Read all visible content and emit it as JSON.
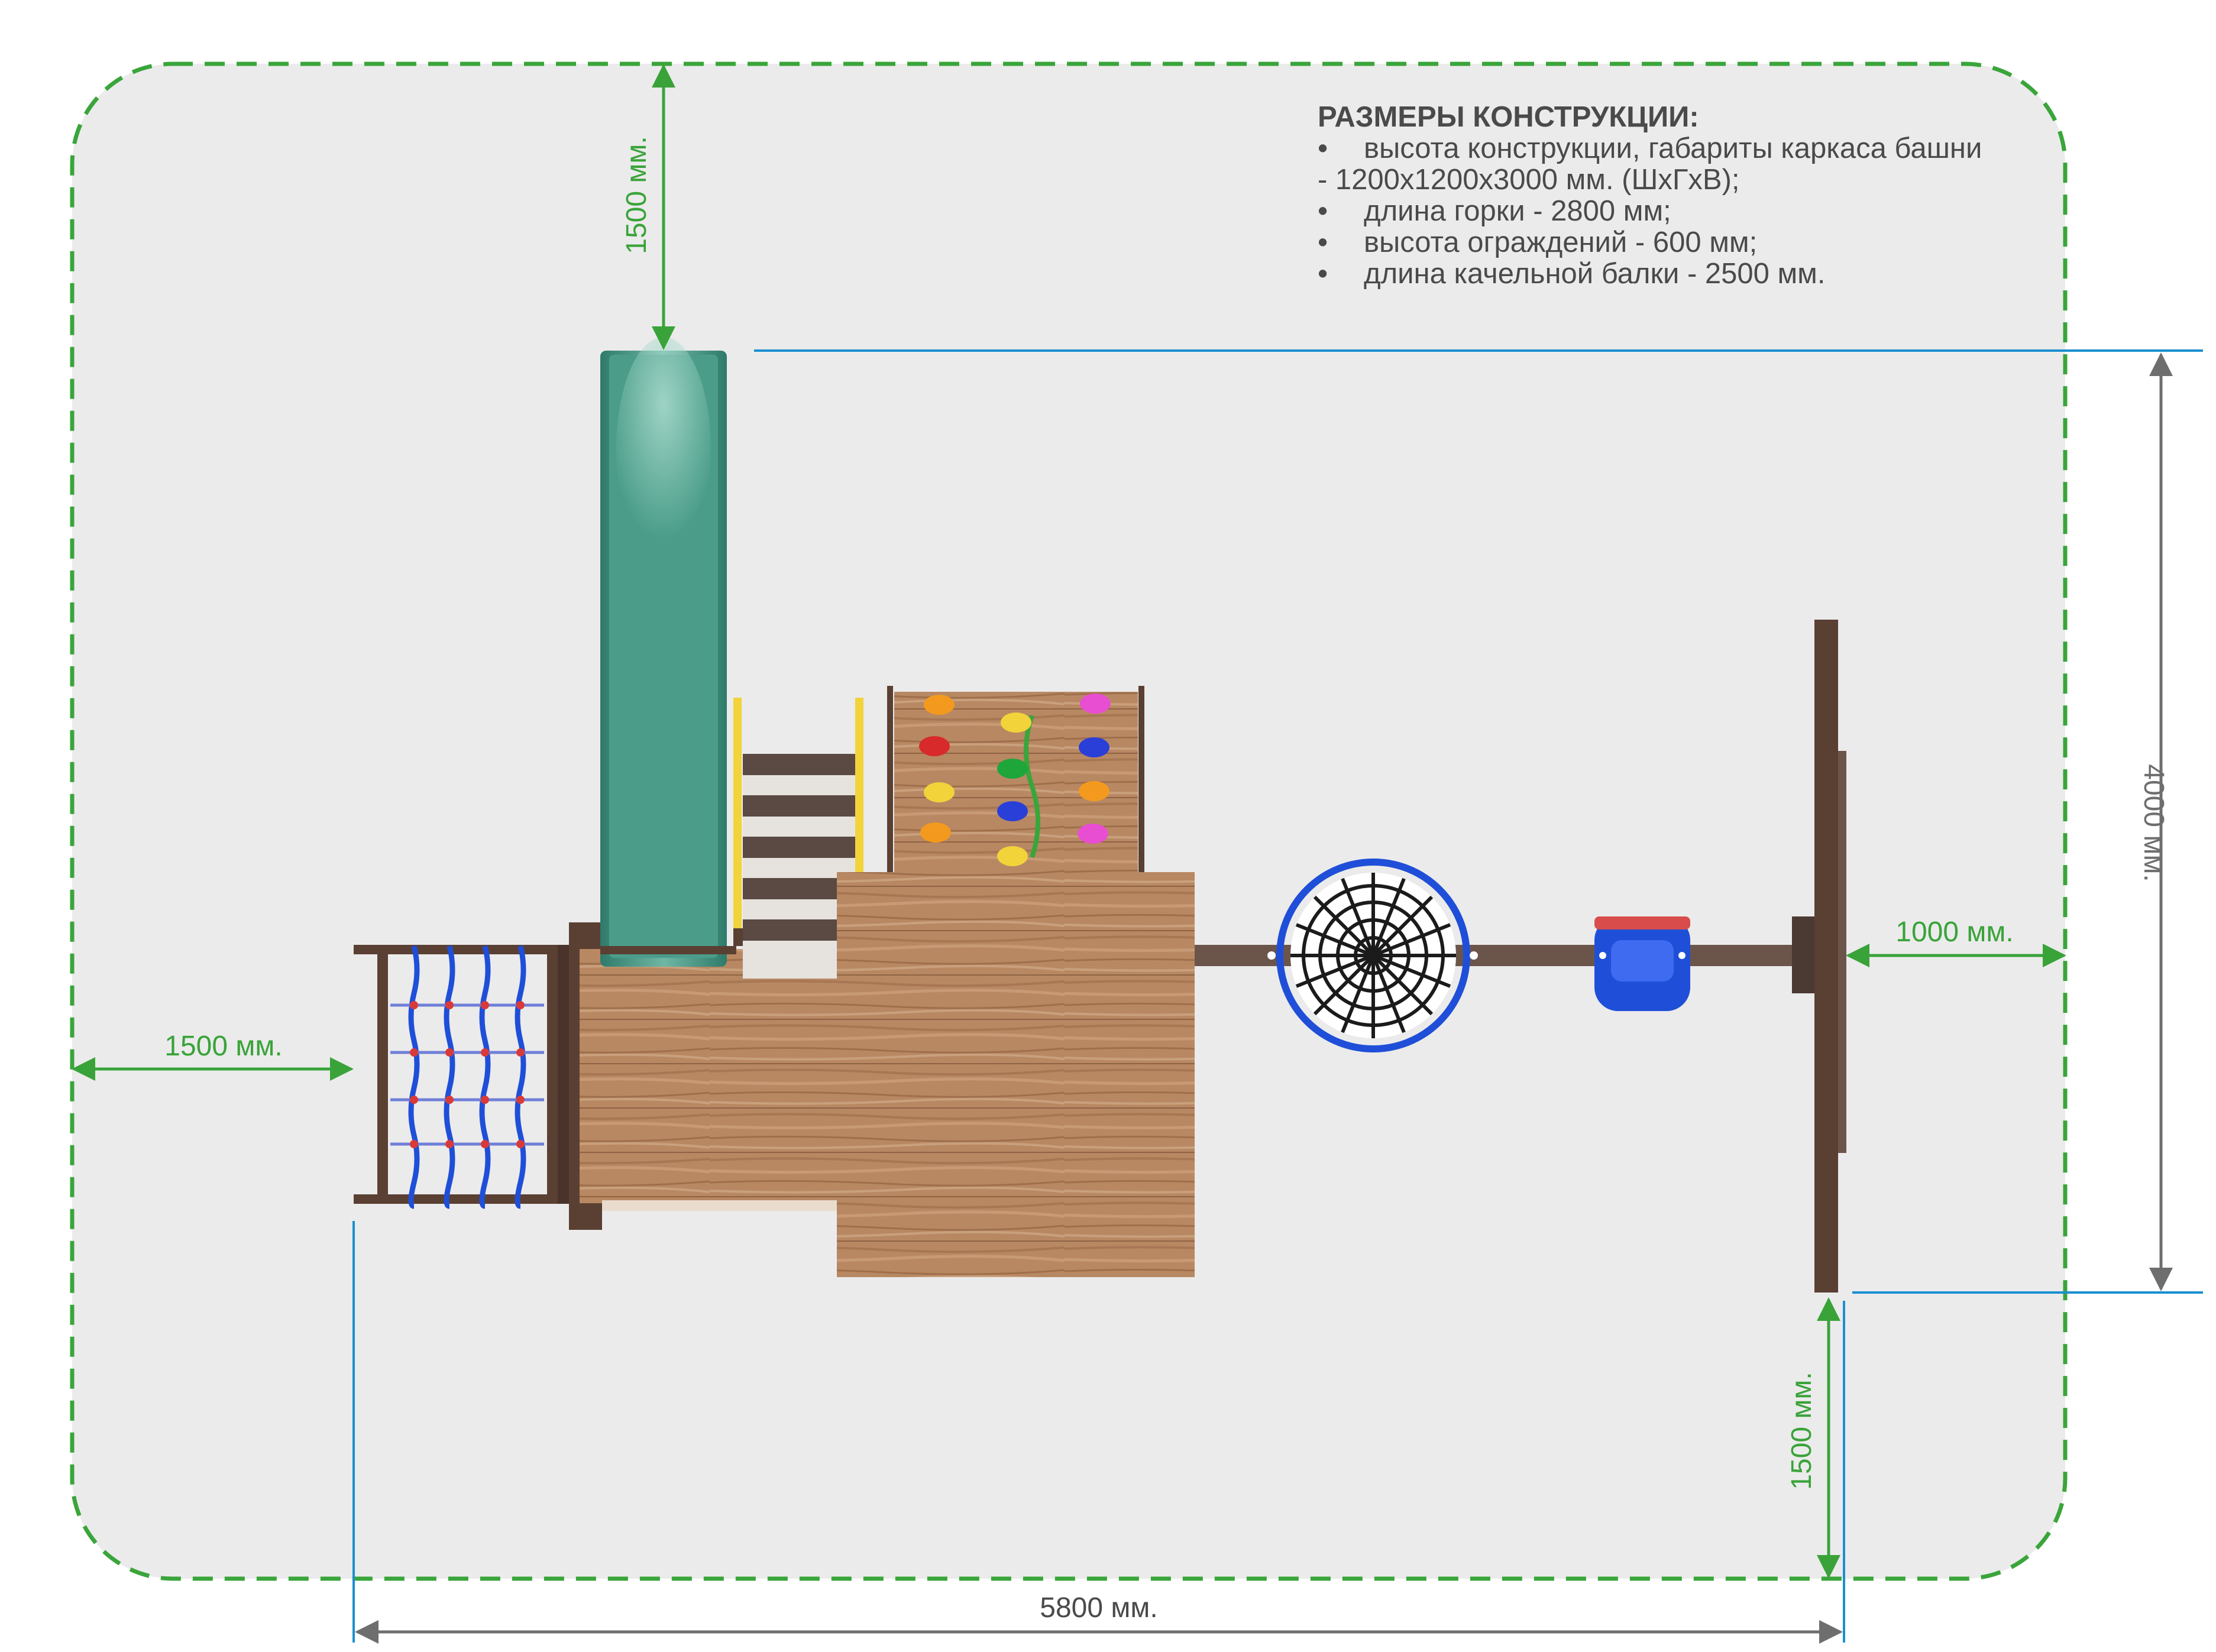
{
  "spec": {
    "title": "РАЗМЕРЫ КОНСТРУКЦИИ:",
    "bullet": "•",
    "lines": [
      {
        "bullet": true,
        "text": "высота конструкции, габариты каркаса башни"
      },
      {
        "bullet": false,
        "text": "- 1200х1200х3000 мм. (ШхГхВ);"
      },
      {
        "bullet": true,
        "text": "длина горки - 2800 мм;"
      },
      {
        "bullet": true,
        "text": "высота ограждений - 600 мм;"
      },
      {
        "bullet": true,
        "text": "длина качельной балки - 2500 мм."
      }
    ]
  },
  "dimensions": {
    "top_clearance": "1500 мм.",
    "left_clearance": "1500 мм.",
    "right_clearance": "1000 мм.",
    "bottom_clearance": "1500 мм.",
    "total_width": "5800 мм.",
    "total_depth": "4000 мм."
  },
  "colors": {
    "zone_fill": "#ebebeb",
    "zone_border": "#3aa53a",
    "dim_green": "#39a339",
    "dim_blue": "#1a8fd0",
    "dim_gray": "#6e6e6e",
    "slide": "#3c8c7d",
    "deck_wood": "#b98a66",
    "frame_brown": "#5a3f33",
    "swing_seat": "#1f4fd8",
    "nest_swing": "#1b1b1b"
  }
}
